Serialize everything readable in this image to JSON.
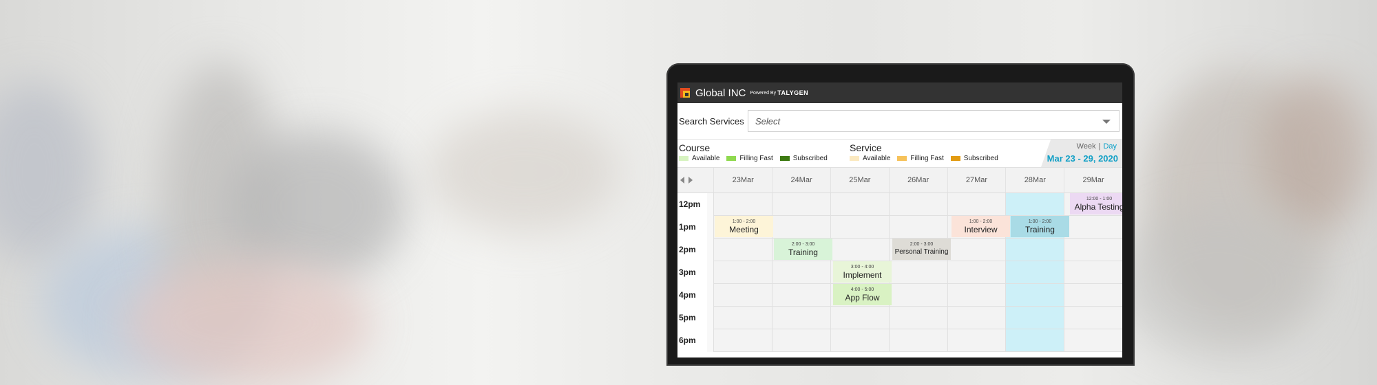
{
  "app": {
    "name": "Global INC",
    "powered_by": "Powered By",
    "brand": "TALYGEN"
  },
  "search": {
    "label": "Search Services",
    "placeholder": "Select"
  },
  "legend": {
    "course": {
      "title": "Course",
      "items": [
        {
          "label": "Available",
          "color": "#d7f3c0"
        },
        {
          "label": "Filling Fast",
          "color": "#8fd94f"
        },
        {
          "label": "Subscribed",
          "color": "#3d7a12"
        }
      ]
    },
    "service": {
      "title": "Service",
      "items": [
        {
          "label": "Available",
          "color": "#fbe9c0"
        },
        {
          "label": "Filling Fast",
          "color": "#f6c25a"
        },
        {
          "label": "Subscribed",
          "color": "#e29b12"
        }
      ]
    }
  },
  "view": {
    "week": "Week",
    "separator": "|",
    "day": "Day",
    "date_range": "Mar 23 - 29, 2020"
  },
  "days": [
    "23Mar",
    "24Mar",
    "25Mar",
    "26Mar",
    "27Mar",
    "28Mar",
    "29Mar"
  ],
  "times": [
    "12pm",
    "1pm",
    "2pm",
    "3pm",
    "4pm",
    "5pm",
    "6pm"
  ],
  "events": [
    {
      "day": 6,
      "slot": 0,
      "time": "12:00 - 1:00",
      "title": "Alpha Testing",
      "color": "#ecd9f3"
    },
    {
      "day": 0,
      "slot": 1,
      "time": "1:00 - 2:00",
      "title": "Meeting",
      "color": "#fdf4d8"
    },
    {
      "day": 4,
      "slot": 1,
      "time": "1:00 - 2:00",
      "title": "Interview",
      "color": "#fbe3d9"
    },
    {
      "day": 5,
      "slot": 1,
      "time": "1:00 - 2:00",
      "title": "Training",
      "color": "#a9dbe6"
    },
    {
      "day": 1,
      "slot": 2,
      "time": "2:00 - 3:00",
      "title": "Training",
      "color": "#d8f3d8"
    },
    {
      "day": 3,
      "slot": 2,
      "time": "2:00 - 3:00",
      "title": "Personal Training",
      "color": "#dedcd6"
    },
    {
      "day": 2,
      "slot": 3,
      "time": "3:00 - 4:00",
      "title": "Implement",
      "color": "#e8f5d8"
    },
    {
      "day": 2,
      "slot": 4,
      "time": "4:00 - 5:00",
      "title": "App Flow",
      "color": "#d9f2c3"
    }
  ]
}
